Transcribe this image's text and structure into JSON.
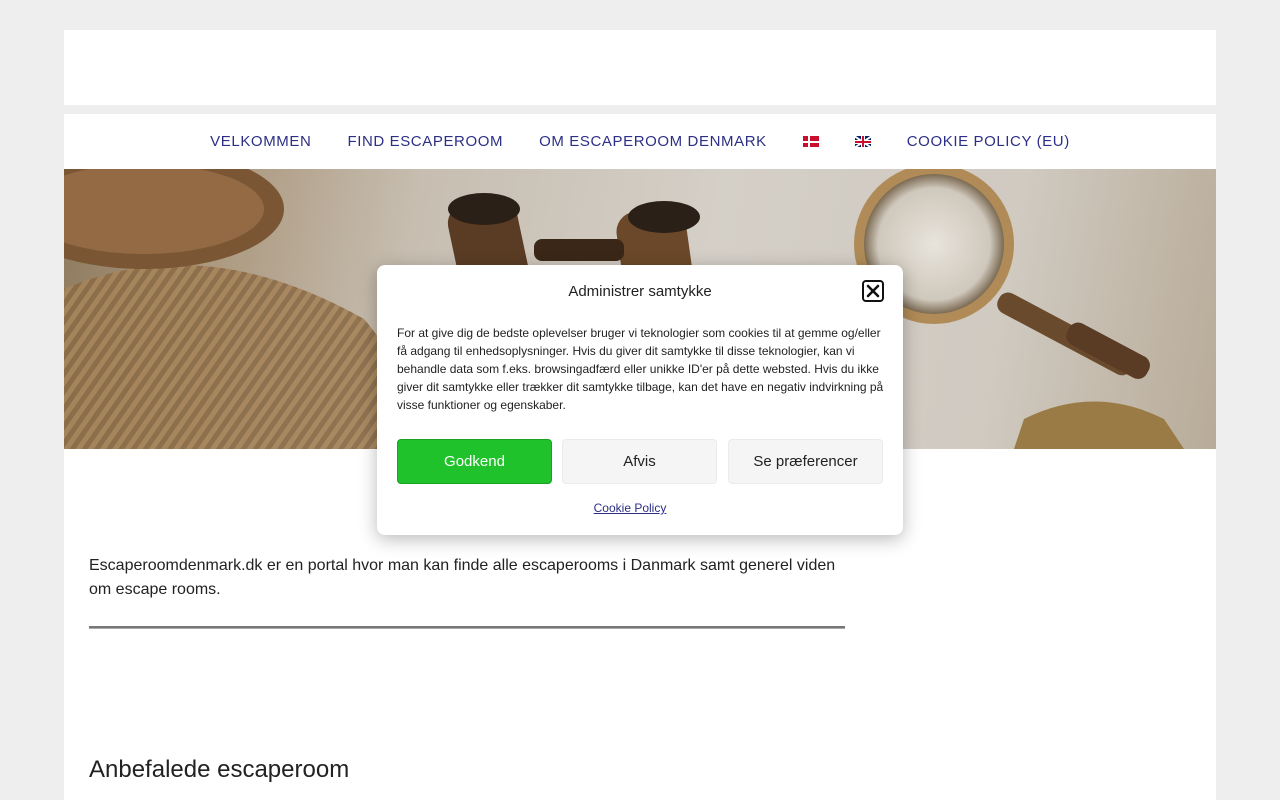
{
  "nav": {
    "items": [
      {
        "label": "VELKOMMEN"
      },
      {
        "label": "FIND ESCAPEROOM"
      },
      {
        "label": "OM ESCAPEROOM DENMARK"
      }
    ],
    "flags": [
      "danish-flag-icon",
      "british-flag-icon"
    ],
    "cookie_policy_label": "COOKIE POLICY (EU)",
    "link_color": "#2d2f86"
  },
  "main": {
    "intro": "Escaperoomdenmark.dk er en portal hvor man kan finde alle escaperooms i Danmark samt generel viden om escape rooms.",
    "section_heading": "Anbefalede escaperoom"
  },
  "consent_modal": {
    "title": "Administrer samtykke",
    "body": "For at give dig de bedste oplevelser bruger vi teknologier som cookies til at gemme og/eller få adgang til enhedsoplysninger. Hvis du giver dit samtykke til disse teknologier, kan vi behandle data som f.eks. browsingadfærd eller unikke ID'er på dette websted. Hvis du ikke giver dit samtykke eller trækker dit samtykke tilbage, kan det have en negativ indvirkning på visse funktioner og egenskaber.",
    "accept_label": "Godkend",
    "deny_label": "Afvis",
    "prefs_label": "Se præferencer",
    "policy_link": "Cookie Policy",
    "accept_color": "#1fc22b",
    "close_icon": "close-icon"
  }
}
